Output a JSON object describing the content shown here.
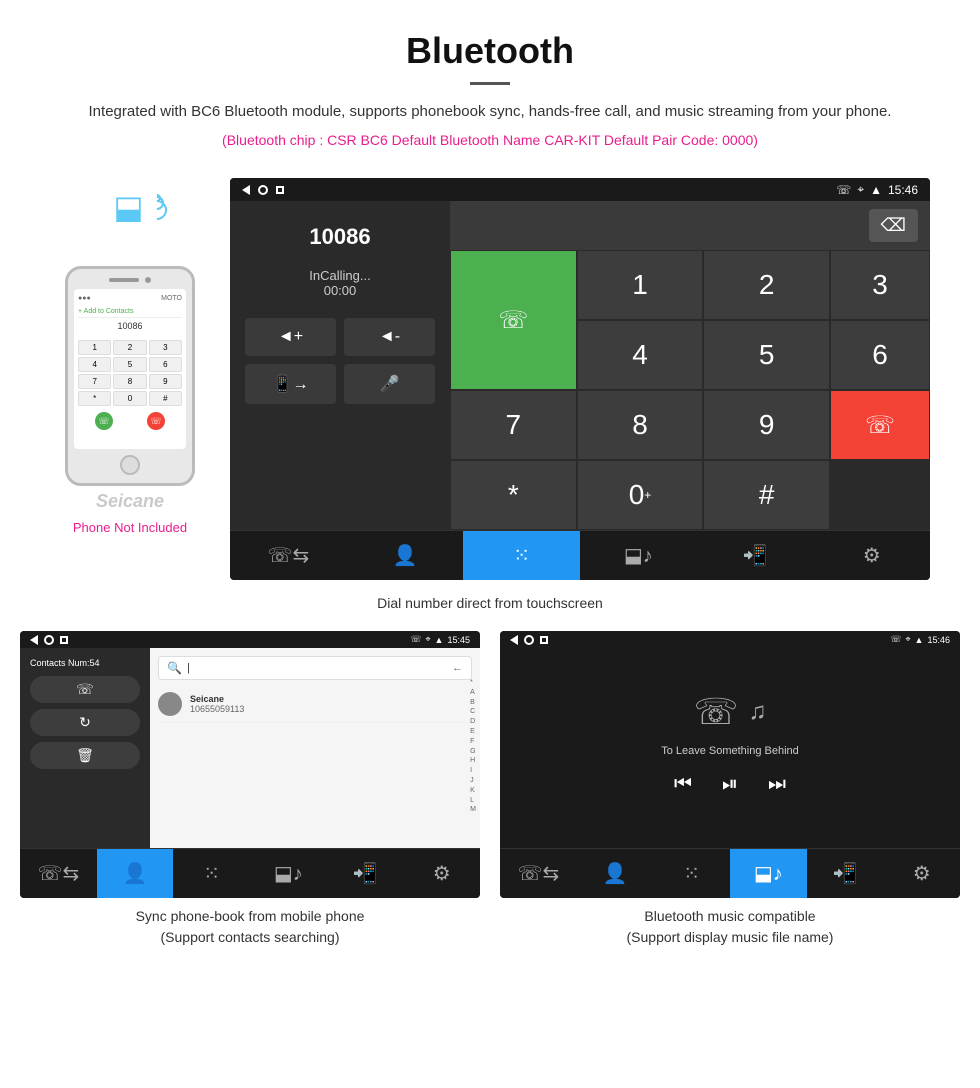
{
  "header": {
    "title": "Bluetooth",
    "description": "Integrated with BC6 Bluetooth module, supports phonebook sync, hands-free call, and music streaming from your phone.",
    "specs": "(Bluetooth chip : CSR BC6    Default Bluetooth Name CAR-KIT    Default Pair Code: 0000)"
  },
  "main_hu": {
    "statusbar": {
      "time": "15:46",
      "icons": [
        "phone",
        "location",
        "wifi"
      ]
    },
    "number": "10086",
    "calling_status": "InCalling...",
    "timer": "00:00",
    "dialpad": [
      "1",
      "2",
      "3",
      "4",
      "5",
      "6",
      "7",
      "8",
      "9",
      "*",
      "0+",
      "#"
    ],
    "nav_items": [
      "phone-transfer",
      "contacts",
      "dialpad",
      "bluetooth",
      "phone-exit",
      "settings"
    ]
  },
  "phone_not_included": "Phone Not Included",
  "main_caption": "Dial number direct from touchscreen",
  "bottom_left": {
    "statusbar_time": "15:45",
    "contacts_num": "Contacts Num:54",
    "contact_name": "Seicane",
    "contact_number": "10655059113",
    "caption_line1": "Sync phone-book from mobile phone",
    "caption_line2": "(Support contacts searching)"
  },
  "bottom_right": {
    "statusbar_time": "15:46",
    "song_title": "To Leave Something Behind",
    "caption_line1": "Bluetooth music compatible",
    "caption_line2": "(Support display music file name)"
  },
  "seicane_watermark": "Seicane"
}
